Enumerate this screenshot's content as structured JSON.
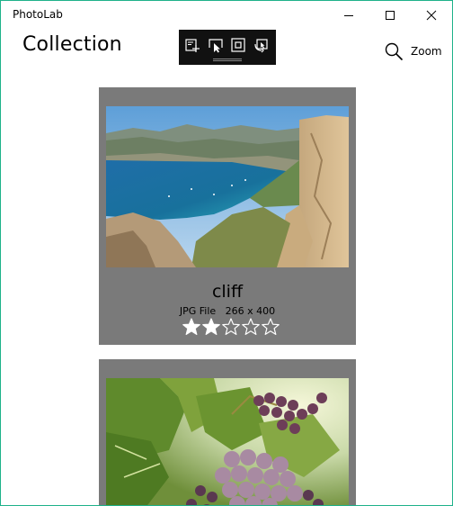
{
  "window": {
    "title": "PhotoLab",
    "accent_border": "#1fb28a",
    "controls": [
      "minimize-icon",
      "maximize-icon",
      "close-icon"
    ]
  },
  "header": {
    "title": "Collection",
    "zoom_label": "Zoom",
    "zoom_icon": "search-icon"
  },
  "toolbar": {
    "background": "#111111",
    "buttons": [
      "add-to-collection-icon",
      "cast-pointer-icon",
      "fit-frame-icon",
      "rotate-frame-icon"
    ]
  },
  "photos": [
    {
      "name": "cliff",
      "file_type": "JPG File",
      "dimensions": "266 x 400",
      "rating": 2,
      "max_rating": 5
    },
    {
      "name": "",
      "file_type": "",
      "dimensions": "",
      "rating": null,
      "max_rating": null
    }
  ],
  "colors": {
    "card_background": "#7a7a7a",
    "star_fill": "#ffffff"
  }
}
